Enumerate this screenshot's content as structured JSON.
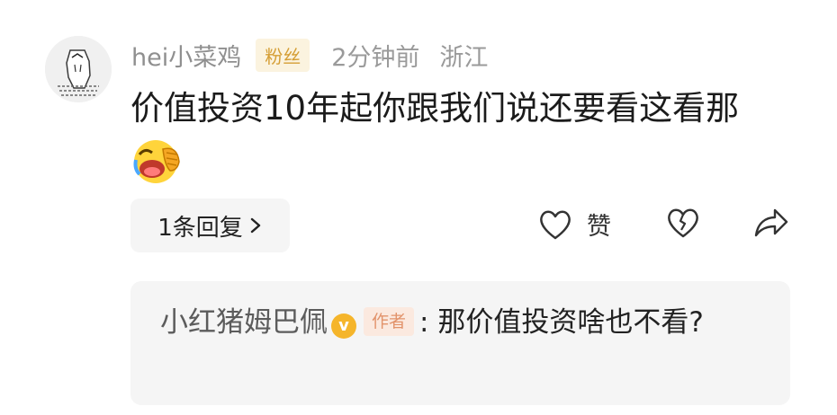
{
  "comment": {
    "username": "hei小菜鸡",
    "fan_badge": "粉丝",
    "time": "2分钟前",
    "location": "浙江",
    "text": "价值投资10年起你跟我们说还要看这看那",
    "emoji": "face-palm-laughing-emoji"
  },
  "reply_count_label": "1条回复",
  "actions": {
    "like_label": "赞",
    "like_icon": "heart-outline-icon",
    "dislike_icon": "broken-heart-icon",
    "share_icon": "share-arrow-icon"
  },
  "reply": {
    "username": "小红猪姆巴佩",
    "verified_icon": "v",
    "author_tag": "作者",
    "separator": ":",
    "text": "那价值投资啥也不看?"
  },
  "colors": {
    "fan_badge_bg": "#fbf3df",
    "fan_badge_text": "#d59e34",
    "verified_badge": "#f5b52b",
    "author_tag_bg": "#fbe9df",
    "author_tag_text": "#e2936b"
  }
}
